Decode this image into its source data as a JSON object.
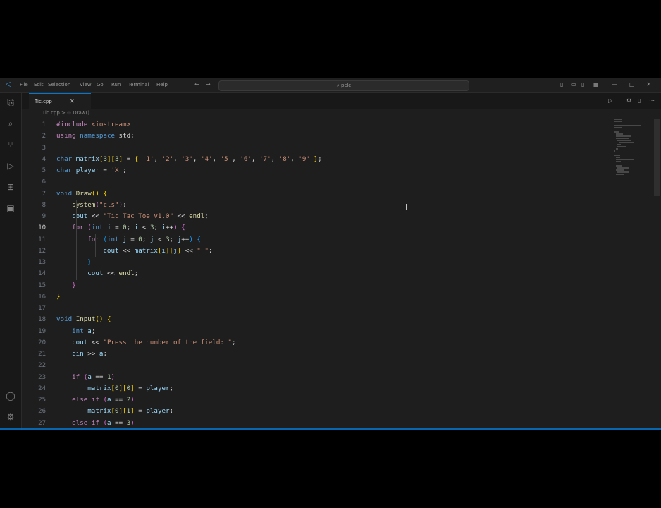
{
  "titlebar": {
    "menu": [
      "File",
      "Edit",
      "Selection",
      "View",
      "Go",
      "Run",
      "Terminal",
      "Help"
    ],
    "search_text": "pclc",
    "nav_back": "←",
    "nav_forward": "→"
  },
  "tab": {
    "name": "Tic.cpp",
    "close": "✕"
  },
  "breadcrumb": "Tic.cpp > ⊙ Draw()",
  "editor": {
    "active_line": 10,
    "lines": [
      [
        [
          "#include",
          "kw2"
        ],
        [
          " <iostream>",
          "str"
        ]
      ],
      [
        [
          "using",
          "kw2"
        ],
        [
          " ",
          "op"
        ],
        [
          "namespace",
          "kw"
        ],
        [
          " std;",
          "op"
        ]
      ],
      [],
      [
        [
          "char",
          "kw"
        ],
        [
          " ",
          "op"
        ],
        [
          "matrix",
          "var"
        ],
        [
          "[",
          "br1"
        ],
        [
          "3",
          "num"
        ],
        [
          "]",
          "br1"
        ],
        [
          "[",
          "br1"
        ],
        [
          "3",
          "num"
        ],
        [
          "]",
          "br1"
        ],
        [
          " = ",
          "op"
        ],
        [
          "{",
          "br1"
        ],
        [
          " ",
          "op"
        ],
        [
          "'1'",
          "str"
        ],
        [
          ", ",
          "op"
        ],
        [
          "'2'",
          "str"
        ],
        [
          ", ",
          "op"
        ],
        [
          "'3'",
          "str"
        ],
        [
          ", ",
          "op"
        ],
        [
          "'4'",
          "str"
        ],
        [
          ", ",
          "op"
        ],
        [
          "'5'",
          "str"
        ],
        [
          ", ",
          "op"
        ],
        [
          "'6'",
          "str"
        ],
        [
          ", ",
          "op"
        ],
        [
          "'7'",
          "str"
        ],
        [
          ", ",
          "op"
        ],
        [
          "'8'",
          "str"
        ],
        [
          ", ",
          "op"
        ],
        [
          "'9'",
          "str"
        ],
        [
          " ",
          "op"
        ],
        [
          "}",
          "br1"
        ],
        [
          ";",
          "op"
        ]
      ],
      [
        [
          "char",
          "kw"
        ],
        [
          " ",
          "op"
        ],
        [
          "player",
          "var"
        ],
        [
          " = ",
          "op"
        ],
        [
          "'X'",
          "str"
        ],
        [
          ";",
          "op"
        ]
      ],
      [],
      [
        [
          "void",
          "kw"
        ],
        [
          " ",
          "op"
        ],
        [
          "Draw",
          "fn"
        ],
        [
          "()",
          "br1"
        ],
        [
          " ",
          "op"
        ],
        [
          "{",
          "br1"
        ]
      ],
      [
        [
          "    ",
          "op"
        ],
        [
          "system",
          "fn"
        ],
        [
          "(",
          "br2"
        ],
        [
          "\"cls\"",
          "str"
        ],
        [
          ")",
          "br2"
        ],
        [
          ";",
          "op"
        ]
      ],
      [
        [
          "    ",
          "op"
        ],
        [
          "cout",
          "var"
        ],
        [
          " << ",
          "op"
        ],
        [
          "\"Tic Tac Toe v1.0\"",
          "str"
        ],
        [
          " << ",
          "op"
        ],
        [
          "endl",
          "fn"
        ],
        [
          ";",
          "op"
        ]
      ],
      [
        [
          "    ",
          "op"
        ],
        [
          "for",
          "kw2"
        ],
        [
          " ",
          "op"
        ],
        [
          "(",
          "br2"
        ],
        [
          "int",
          "kw"
        ],
        [
          " ",
          "op"
        ],
        [
          "i",
          "var"
        ],
        [
          " = ",
          "op"
        ],
        [
          "0",
          "num"
        ],
        [
          "; ",
          "op"
        ],
        [
          "i",
          "var"
        ],
        [
          " < ",
          "op"
        ],
        [
          "3",
          "num"
        ],
        [
          "; ",
          "op"
        ],
        [
          "i",
          "var"
        ],
        [
          "++",
          "op"
        ],
        [
          ")",
          "br2"
        ],
        [
          " ",
          "op"
        ],
        [
          "{",
          "br2"
        ]
      ],
      [
        [
          "        ",
          "op"
        ],
        [
          "for",
          "kw2"
        ],
        [
          " ",
          "op"
        ],
        [
          "(",
          "br3"
        ],
        [
          "int",
          "kw"
        ],
        [
          " ",
          "op"
        ],
        [
          "j",
          "var"
        ],
        [
          " = ",
          "op"
        ],
        [
          "0",
          "num"
        ],
        [
          "; ",
          "op"
        ],
        [
          "j",
          "var"
        ],
        [
          " < ",
          "op"
        ],
        [
          "3",
          "num"
        ],
        [
          "; ",
          "op"
        ],
        [
          "j",
          "var"
        ],
        [
          "++",
          "op"
        ],
        [
          ")",
          "br3"
        ],
        [
          " ",
          "op"
        ],
        [
          "{",
          "br3"
        ]
      ],
      [
        [
          "            ",
          "op"
        ],
        [
          "cout",
          "var"
        ],
        [
          " << ",
          "op"
        ],
        [
          "matrix",
          "var"
        ],
        [
          "[",
          "br1"
        ],
        [
          "i",
          "var"
        ],
        [
          "]",
          "br1"
        ],
        [
          "[",
          "br1"
        ],
        [
          "j",
          "var"
        ],
        [
          "]",
          "br1"
        ],
        [
          " << ",
          "op"
        ],
        [
          "\" \"",
          "str"
        ],
        [
          ";",
          "op"
        ]
      ],
      [
        [
          "        ",
          "op"
        ],
        [
          "}",
          "br3"
        ]
      ],
      [
        [
          "        ",
          "op"
        ],
        [
          "cout",
          "var"
        ],
        [
          " << ",
          "op"
        ],
        [
          "endl",
          "fn"
        ],
        [
          ";",
          "op"
        ]
      ],
      [
        [
          "    ",
          "op"
        ],
        [
          "}",
          "br2"
        ]
      ],
      [
        [
          "}",
          "br1"
        ]
      ],
      [],
      [
        [
          "void",
          "kw"
        ],
        [
          " ",
          "op"
        ],
        [
          "Input",
          "fn"
        ],
        [
          "()",
          "br1"
        ],
        [
          " ",
          "op"
        ],
        [
          "{",
          "br1"
        ]
      ],
      [
        [
          "    ",
          "op"
        ],
        [
          "int",
          "kw"
        ],
        [
          " ",
          "op"
        ],
        [
          "a",
          "var"
        ],
        [
          ";",
          "op"
        ]
      ],
      [
        [
          "    ",
          "op"
        ],
        [
          "cout",
          "var"
        ],
        [
          " << ",
          "op"
        ],
        [
          "\"Press the number of the field: \"",
          "str"
        ],
        [
          ";",
          "op"
        ]
      ],
      [
        [
          "    ",
          "op"
        ],
        [
          "cin",
          "var"
        ],
        [
          " >> ",
          "op"
        ],
        [
          "a",
          "var"
        ],
        [
          ";",
          "op"
        ]
      ],
      [],
      [
        [
          "    ",
          "op"
        ],
        [
          "if",
          "kw2"
        ],
        [
          " ",
          "op"
        ],
        [
          "(",
          "br2"
        ],
        [
          "a",
          "var"
        ],
        [
          " == ",
          "op"
        ],
        [
          "1",
          "num"
        ],
        [
          ")",
          "br2"
        ]
      ],
      [
        [
          "        ",
          "op"
        ],
        [
          "matrix",
          "var"
        ],
        [
          "[",
          "br1"
        ],
        [
          "0",
          "num"
        ],
        [
          "]",
          "br1"
        ],
        [
          "[",
          "br1"
        ],
        [
          "0",
          "num"
        ],
        [
          "]",
          "br1"
        ],
        [
          " = ",
          "op"
        ],
        [
          "player",
          "var"
        ],
        [
          ";",
          "op"
        ]
      ],
      [
        [
          "    ",
          "op"
        ],
        [
          "else",
          "kw2"
        ],
        [
          " ",
          "op"
        ],
        [
          "if",
          "kw2"
        ],
        [
          " ",
          "op"
        ],
        [
          "(",
          "br2"
        ],
        [
          "a",
          "var"
        ],
        [
          " == ",
          "op"
        ],
        [
          "2",
          "num"
        ],
        [
          ")",
          "br2"
        ]
      ],
      [
        [
          "        ",
          "op"
        ],
        [
          "matrix",
          "var"
        ],
        [
          "[",
          "br1"
        ],
        [
          "0",
          "num"
        ],
        [
          "]",
          "br1"
        ],
        [
          "[",
          "br1"
        ],
        [
          "1",
          "num"
        ],
        [
          "]",
          "br1"
        ],
        [
          " = ",
          "op"
        ],
        [
          "player",
          "var"
        ],
        [
          ";",
          "op"
        ]
      ],
      [
        [
          "    ",
          "op"
        ],
        [
          "else",
          "kw2"
        ],
        [
          " ",
          "op"
        ],
        [
          "if",
          "kw2"
        ],
        [
          " ",
          "op"
        ],
        [
          "(",
          "br2"
        ],
        [
          "a",
          "var"
        ],
        [
          " == ",
          "op"
        ],
        [
          "3",
          "num"
        ],
        [
          ")",
          "br2"
        ]
      ]
    ]
  },
  "icons": {
    "app": "vscode-logo-icon",
    "explorer": "files-icon",
    "search": "search-icon",
    "source_control": "source-control-icon",
    "run": "run-debug-icon",
    "extensions": "extensions-icon",
    "remote": "remote-explorer-icon",
    "accounts": "account-icon",
    "settings": "gear-icon"
  },
  "colors": {
    "accent": "#0078d4",
    "background": "#1e1e1e"
  }
}
